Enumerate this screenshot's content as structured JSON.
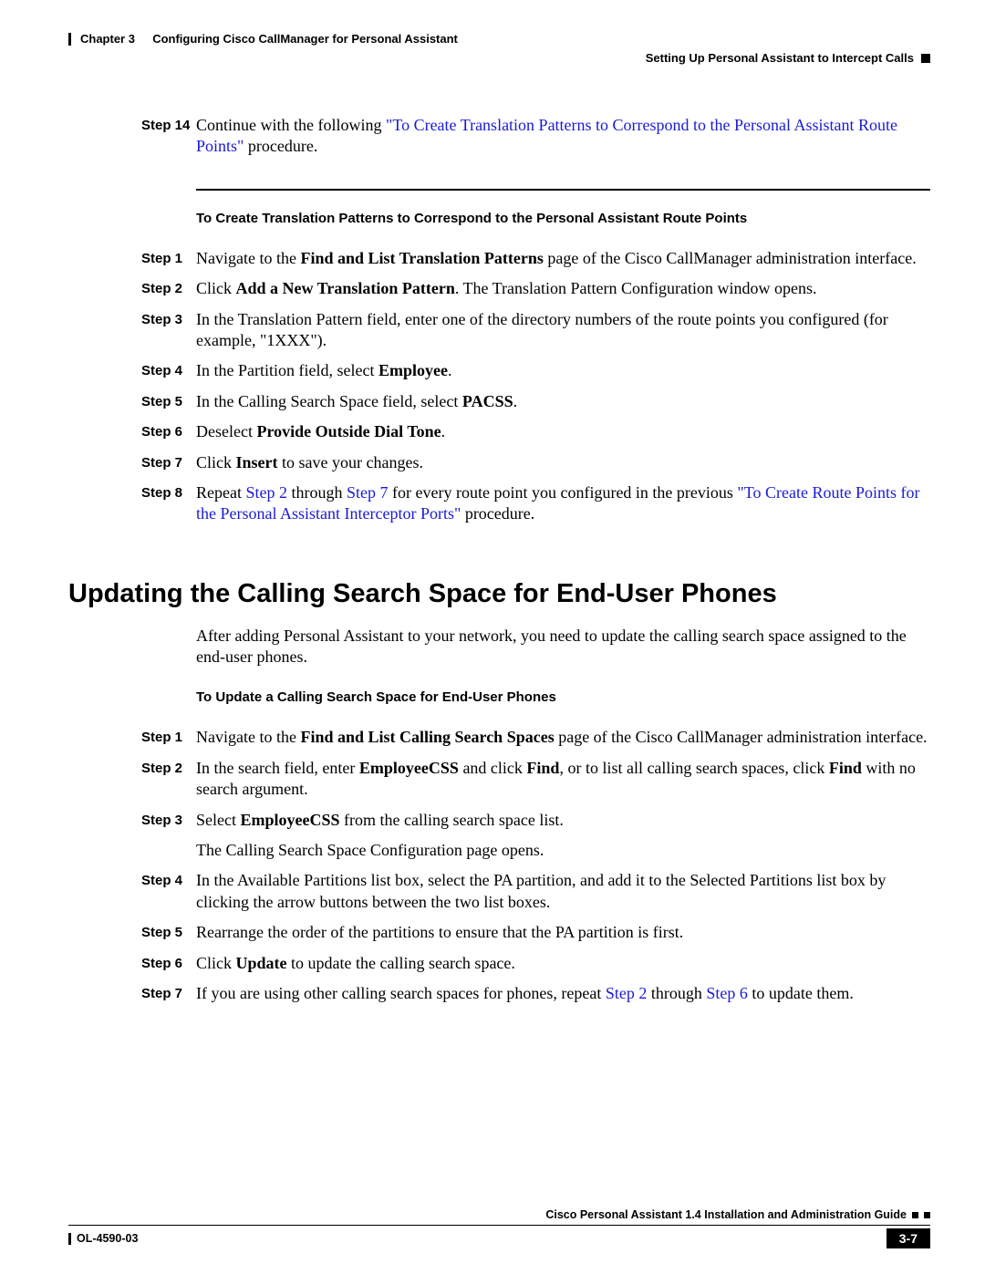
{
  "header": {
    "chapter": "Chapter 3",
    "chapter_title": "Configuring Cisco CallManager for Personal Assistant",
    "section": "Setting Up Personal Assistant to Intercept Calls"
  },
  "step14": {
    "label": "Step 14",
    "text1": "Continue with the following ",
    "link": "\"To Create Translation Patterns to Correspond to the Personal Assistant Route Points\"",
    "text2": " procedure."
  },
  "sub1_title": "To Create Translation Patterns to Correspond to the Personal Assistant Route Points",
  "sub1_steps": [
    {
      "label": "Step 1",
      "parts": [
        {
          "t": "Navigate to the "
        },
        {
          "b": "Find and List Translation Patterns"
        },
        {
          "t": " page of the Cisco CallManager administration interface."
        }
      ]
    },
    {
      "label": "Step 2",
      "parts": [
        {
          "t": "Click "
        },
        {
          "b": "Add a New Translation Pattern"
        },
        {
          "t": ". The Translation Pattern Configuration window opens."
        }
      ]
    },
    {
      "label": "Step 3",
      "parts": [
        {
          "t": "In the Translation Pattern field, enter one of the directory numbers of the route points you configured (for example, \"1XXX\")."
        }
      ]
    },
    {
      "label": "Step 4",
      "parts": [
        {
          "t": "In the Partition field, select "
        },
        {
          "b": "Employee"
        },
        {
          "t": "."
        }
      ]
    },
    {
      "label": "Step 5",
      "parts": [
        {
          "t": "In the Calling Search Space field, select "
        },
        {
          "b": "PACSS"
        },
        {
          "t": "."
        }
      ]
    },
    {
      "label": "Step 6",
      "parts": [
        {
          "t": "Deselect "
        },
        {
          "b": "Provide Outside Dial Tone"
        },
        {
          "t": "."
        }
      ]
    },
    {
      "label": "Step 7",
      "parts": [
        {
          "t": "Click "
        },
        {
          "b": "Insert"
        },
        {
          "t": " to save your changes."
        }
      ]
    },
    {
      "label": "Step 8",
      "parts": [
        {
          "t": "Repeat "
        },
        {
          "link": "Step 2"
        },
        {
          "t": " through "
        },
        {
          "link": "Step 7"
        },
        {
          "t": " for every route point you configured in the previous "
        },
        {
          "link": "\"To Create Route Points for the Personal Assistant Interceptor Ports\""
        },
        {
          "t": " procedure."
        }
      ]
    }
  ],
  "h2": "Updating the Calling Search Space for End-User Phones",
  "intro": "After adding Personal Assistant to your network, you need to update the calling search space assigned to the end-user phones.",
  "sub2_title": "To Update a Calling Search Space for End-User Phones",
  "sub2_steps": [
    {
      "label": "Step 1",
      "parts": [
        {
          "t": "Navigate to the "
        },
        {
          "b": "Find and List Calling Search Spaces"
        },
        {
          "t": " page of the Cisco CallManager administration interface."
        }
      ]
    },
    {
      "label": "Step 2",
      "parts": [
        {
          "t": "In the search field, enter "
        },
        {
          "b": "EmployeeCSS"
        },
        {
          "t": " and click "
        },
        {
          "b": "Find"
        },
        {
          "t": ", or to list all calling search spaces, click "
        },
        {
          "b": "Find"
        },
        {
          "t": " with no search argument."
        }
      ]
    },
    {
      "label": "Step 3",
      "parts": [
        {
          "t": "Select "
        },
        {
          "b": "EmployeeCSS"
        },
        {
          "t": " from the calling search space list."
        }
      ],
      "extra": "The Calling Search Space Configuration page opens."
    },
    {
      "label": "Step 4",
      "parts": [
        {
          "t": "In the Available Partitions list box, select the PA partition, and add it to the Selected Partitions list box by clicking the arrow buttons between the two list boxes."
        }
      ]
    },
    {
      "label": "Step 5",
      "parts": [
        {
          "t": "Rearrange the order of the partitions to ensure that the PA partition is first."
        }
      ]
    },
    {
      "label": "Step 6",
      "parts": [
        {
          "t": "Click "
        },
        {
          "b": "Update"
        },
        {
          "t": " to update the calling search space."
        }
      ]
    },
    {
      "label": "Step 7",
      "parts": [
        {
          "t": "If you are using other calling search spaces for phones, repeat "
        },
        {
          "link": "Step 2"
        },
        {
          "t": " through "
        },
        {
          "link": "Step 6"
        },
        {
          "t": " to update them."
        }
      ]
    }
  ],
  "footer": {
    "guide": "Cisco Personal Assistant 1.4 Installation and Administration Guide",
    "doc_id": "OL-4590-03",
    "page": "3-7"
  }
}
